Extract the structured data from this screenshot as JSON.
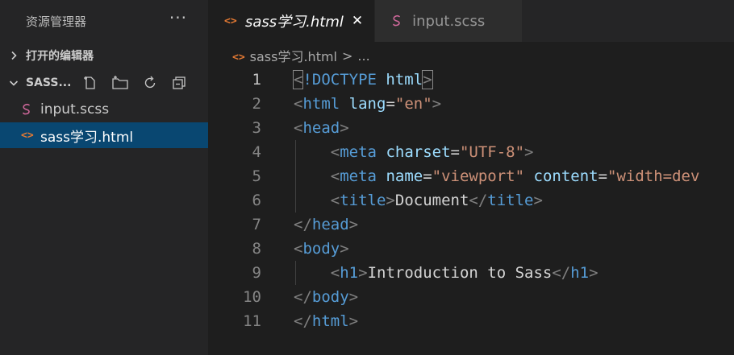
{
  "sidebar": {
    "title": "资源管理器",
    "more": "···",
    "open_editors_label": "打开的编辑器",
    "project_label": "SASS...",
    "files": [
      {
        "name": "input.scss",
        "icon": "sass-icon",
        "active": false
      },
      {
        "name": "sass学习.html",
        "icon": "html-icon",
        "active": true
      }
    ]
  },
  "tabs": [
    {
      "label": "sass学习.html",
      "icon": "html-icon",
      "active": true,
      "close": "✕"
    },
    {
      "label": "input.scss",
      "icon": "sass-icon",
      "active": false
    }
  ],
  "breadcrumb": {
    "file": "sass学习.html",
    "sep": ">",
    "tail": "..."
  },
  "icons": {
    "html_glyph": "<>"
  },
  "code": {
    "line_numbers": [
      "1",
      "2",
      "3",
      "4",
      "5",
      "6",
      "7",
      "8",
      "9",
      "10",
      "11"
    ],
    "active_line": 1,
    "lines": [
      [
        [
          "p",
          "<"
        ],
        [
          "t",
          "!DOCTYPE"
        ],
        [
          "x",
          " "
        ],
        [
          "a",
          "html"
        ],
        [
          "p",
          ">"
        ]
      ],
      [
        [
          "p",
          "<"
        ],
        [
          "t",
          "html"
        ],
        [
          "x",
          " "
        ],
        [
          "a",
          "lang"
        ],
        [
          "x",
          "="
        ],
        [
          "s",
          "\"en\""
        ],
        [
          "p",
          ">"
        ]
      ],
      [
        [
          "p",
          "<"
        ],
        [
          "t",
          "head"
        ],
        [
          "p",
          ">"
        ]
      ],
      [
        [
          "x",
          "    "
        ],
        [
          "p",
          "<"
        ],
        [
          "t",
          "meta"
        ],
        [
          "x",
          " "
        ],
        [
          "a",
          "charset"
        ],
        [
          "x",
          "="
        ],
        [
          "s",
          "\"UTF-8\""
        ],
        [
          "p",
          ">"
        ]
      ],
      [
        [
          "x",
          "    "
        ],
        [
          "p",
          "<"
        ],
        [
          "t",
          "meta"
        ],
        [
          "x",
          " "
        ],
        [
          "a",
          "name"
        ],
        [
          "x",
          "="
        ],
        [
          "s",
          "\"viewport\""
        ],
        [
          "x",
          " "
        ],
        [
          "a",
          "content"
        ],
        [
          "x",
          "="
        ],
        [
          "s",
          "\"width=dev"
        ]
      ],
      [
        [
          "x",
          "    "
        ],
        [
          "p",
          "<"
        ],
        [
          "t",
          "title"
        ],
        [
          "p",
          ">"
        ],
        [
          "x",
          "Document"
        ],
        [
          "p",
          "</"
        ],
        [
          "t",
          "title"
        ],
        [
          "p",
          ">"
        ]
      ],
      [
        [
          "p",
          "</"
        ],
        [
          "t",
          "head"
        ],
        [
          "p",
          ">"
        ]
      ],
      [
        [
          "p",
          "<"
        ],
        [
          "t",
          "body"
        ],
        [
          "p",
          ">"
        ]
      ],
      [
        [
          "x",
          "    "
        ],
        [
          "p",
          "<"
        ],
        [
          "t",
          "h1"
        ],
        [
          "p",
          ">"
        ],
        [
          "x",
          "Introduction to Sass"
        ],
        [
          "p",
          "</"
        ],
        [
          "t",
          "h1"
        ],
        [
          "p",
          ">"
        ]
      ],
      [
        [
          "p",
          "</"
        ],
        [
          "t",
          "body"
        ],
        [
          "p",
          ">"
        ]
      ],
      [
        [
          "p",
          "</"
        ],
        [
          "t",
          "html"
        ],
        [
          "p",
          ">"
        ]
      ]
    ]
  },
  "colors": {
    "tag": "#569cd6",
    "attr": "#9cdcfe",
    "string": "#ce9178",
    "punctuation": "#808080",
    "text": "#d4d4d4",
    "selection": "#094771",
    "html_icon": "#e37933",
    "sass_icon": "#cd6799"
  }
}
